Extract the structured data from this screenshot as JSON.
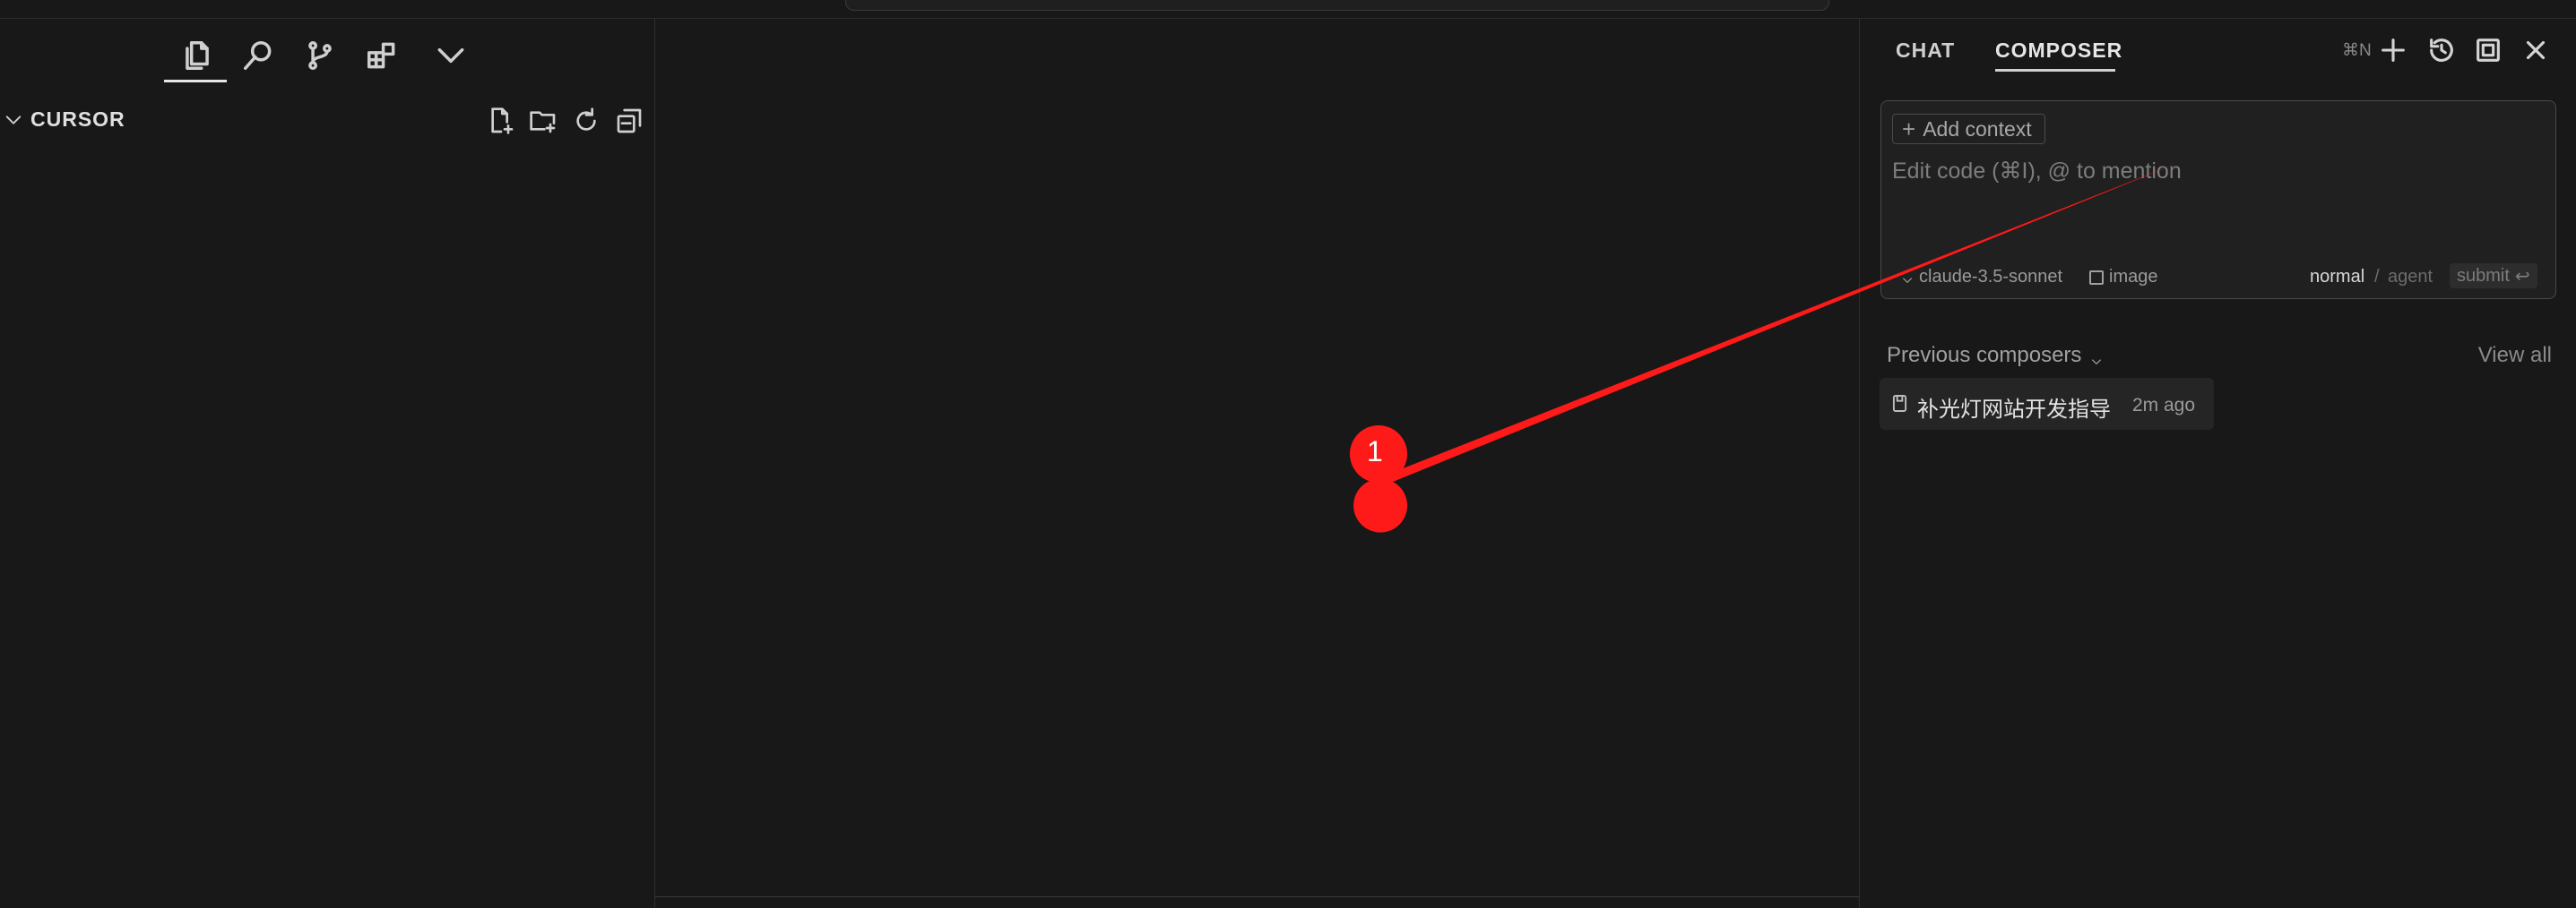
{
  "sidebar": {
    "activity_icons": [
      "files-icon",
      "search-icon",
      "source-control-icon",
      "extensions-icon",
      "chevron-down-icon"
    ],
    "explorer_title": "CURSOR",
    "explorer_tools": [
      "new-file-icon",
      "new-folder-icon",
      "refresh-icon",
      "collapse-all-icon"
    ]
  },
  "panel": {
    "tabs": [
      {
        "label": "CHAT",
        "active": false
      },
      {
        "label": "COMPOSER",
        "active": true
      }
    ],
    "new_shortcut": "⌘N",
    "tools": [
      "plus-icon",
      "history-icon",
      "maximize-icon",
      "close-icon"
    ],
    "composer": {
      "add_context_label": "Add context",
      "placeholder": "Edit code (⌘I), @ to mention",
      "model": "claude-3.5-sonnet",
      "image_label": "image",
      "mode_normal": "normal",
      "mode_separator": "/",
      "mode_agent": "agent",
      "submit_label": "submit"
    },
    "previous": {
      "heading": "Previous composers",
      "view_all": "View all",
      "items": [
        {
          "title": "补光灯网站开发指导",
          "time": "2m ago"
        }
      ]
    }
  },
  "annotation": {
    "label": "1",
    "color": "#ff1a1a"
  }
}
